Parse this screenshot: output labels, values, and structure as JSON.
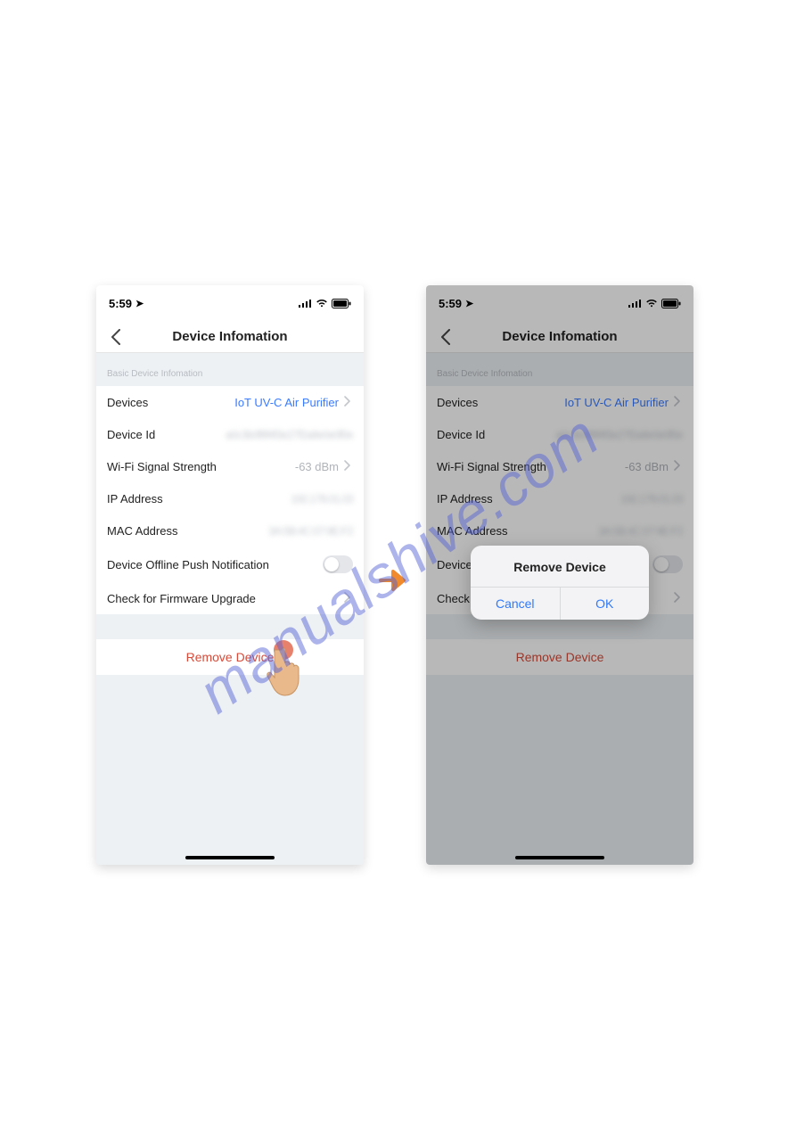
{
  "watermark": "manualshive.com",
  "status": {
    "time": "5:59",
    "loc_glyph": "➤"
  },
  "nav": {
    "title": "Device Infomation"
  },
  "section_header": "Basic Device Infomation",
  "rows": {
    "devices_label": "Devices",
    "devices_value": "IoT UV-C Air Purifier",
    "device_id_label": "Device Id",
    "device_id_value": "a0c3b0f8f4f3e27f2a8e0e0f0e",
    "wifi_label": "Wi-Fi Signal Strength",
    "wifi_value": "-63 dBm",
    "ip_label": "IP Address",
    "ip_value": "192.178.01.03",
    "mac_label": "MAC Address",
    "mac_value": "3A:5B:4C:07:9E:F2",
    "offline_label": "Device Offline Push Notification",
    "fw_label": "Check for Firmware Upgrade"
  },
  "remove_label": "Remove Device",
  "dialog": {
    "title": "Remove Device",
    "cancel": "Cancel",
    "ok": "OK"
  }
}
